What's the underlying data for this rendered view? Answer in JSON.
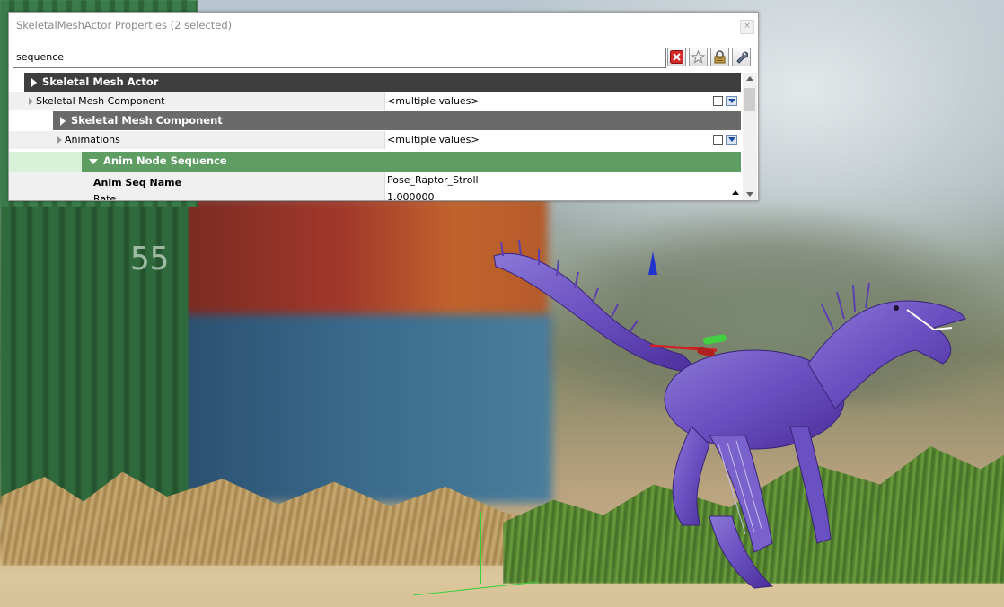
{
  "window": {
    "title": "SkeletalMeshActor Properties (2 selected)",
    "close_glyph": "×"
  },
  "search": {
    "value": "sequence"
  },
  "toolbar": {
    "icons": [
      "clear-search-icon",
      "favorite-star-icon",
      "lock-icon",
      "wrench-options-icon"
    ]
  },
  "properties": {
    "cat_actor": "Skeletal Mesh Actor",
    "skeletal_mesh_component": {
      "name": "Skeletal Mesh Component",
      "value": "<multiple values>"
    },
    "cat_component": "Skeletal Mesh Component",
    "animations": {
      "name": "Animations",
      "value": "<multiple values>"
    },
    "cat_anim_node": "Anim Node Sequence",
    "anim_seq_name": {
      "name": "Anim Seq Name",
      "value": "Pose_Raptor_Stroll"
    },
    "rate": {
      "name": "Rate",
      "value": "1.000000"
    }
  },
  "colors": {
    "category_dark": "#3e3e3e",
    "category_mid": "#6a6a6a",
    "category_green": "#5f9e63",
    "category_green_light": "#d7f2d7"
  }
}
